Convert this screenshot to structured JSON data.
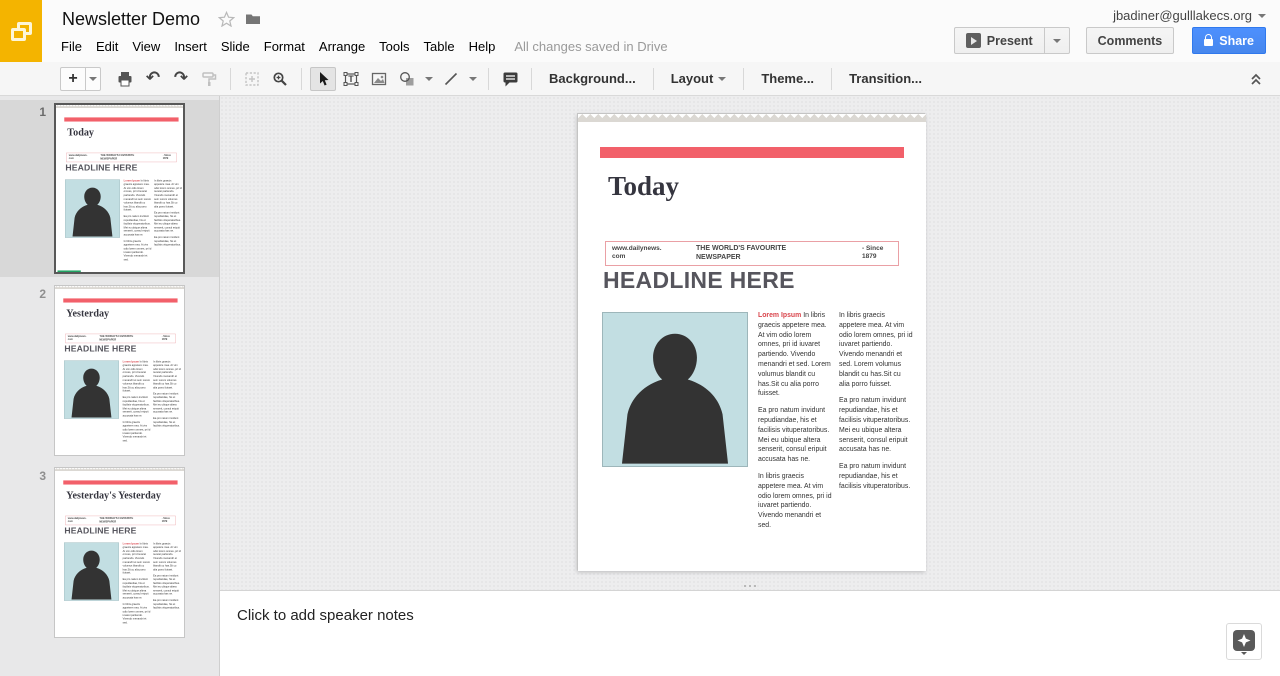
{
  "header": {
    "document_title": "Newsletter Demo",
    "account_email": "jbadiner@gulllakecs.org",
    "menus": [
      "File",
      "Edit",
      "View",
      "Insert",
      "Slide",
      "Format",
      "Arrange",
      "Tools",
      "Table",
      "Help"
    ],
    "save_status": "All changes saved in Drive",
    "buttons": {
      "present": "Present",
      "comments": "Comments",
      "share": "Share"
    }
  },
  "toolbar": {
    "new_slide_label": "+",
    "undo_glyph": "↶",
    "redo_glyph": "↷",
    "background_label": "Background...",
    "layout_label": "Layout",
    "theme_label": "Theme...",
    "transition_label": "Transition...",
    "icons": [
      "new-slide",
      "new-slide-dropdown",
      "print",
      "undo",
      "redo",
      "paint-format",
      "zoom-fit",
      "zoom",
      "select",
      "text-box",
      "insert-image",
      "insert-shape",
      "insert-line",
      "insert-comment",
      "collapse-toolbar"
    ]
  },
  "filmstrip": {
    "slides": [
      {
        "number": "1",
        "title": "Today",
        "selected": true
      },
      {
        "number": "2",
        "title": "Yesterday",
        "selected": false
      },
      {
        "number": "3",
        "title": "Yesterday's Yesterday",
        "selected": false
      }
    ]
  },
  "newspaper": {
    "masthead_url": "www.dailynews.com",
    "masthead_tagline": "THE WORLD'S FAVOURITE NEWSPAPER",
    "masthead_since": "- Since 1879",
    "headline": "HEADLINE HERE",
    "lead_in": "Lorem Ipsum",
    "col1": [
      "In libris graecis appetere mea. At vim odio lorem omnes, pri id iuvaret partiendo. Vivendo menandri et sed. Lorem volumus blandit cu has.Sit cu alia porro fuisset.",
      "Ea pro natum invidunt repudiandae, his et facilisis vituperatoribus. Mei eu ubique altera senserit, consul eripuit accusata has ne.",
      "In libris graecis appetere mea. At vim odio lorem omnes, pri id iuvaret partiendo. Vivendo menandri et sed."
    ],
    "col2": [
      "In libris graecis appetere mea. At vim odio lorem omnes, pri id iuvaret partiendo. Vivendo menandri et sed. Lorem volumus blandit cu has.Sit cu alia porro fuisset.",
      "Ea pro natum invidunt repudiandae, his et facilisis vituperatoribus. Mei eu ubique altera senserit, consul eripuit accusata has ne.",
      "Ea pro natum invidunt repudiandae, his et facilisis vituperatoribus."
    ]
  },
  "notes": {
    "placeholder": "Click to add speaker notes"
  },
  "colors": {
    "brand_yellow": "#F4B400",
    "share_blue": "#4D90FE",
    "accent_red": "#F2606A",
    "photo_teal": "#C2DEE2",
    "lead_in_red": "#D9454C",
    "progress_green": "#21A463"
  }
}
